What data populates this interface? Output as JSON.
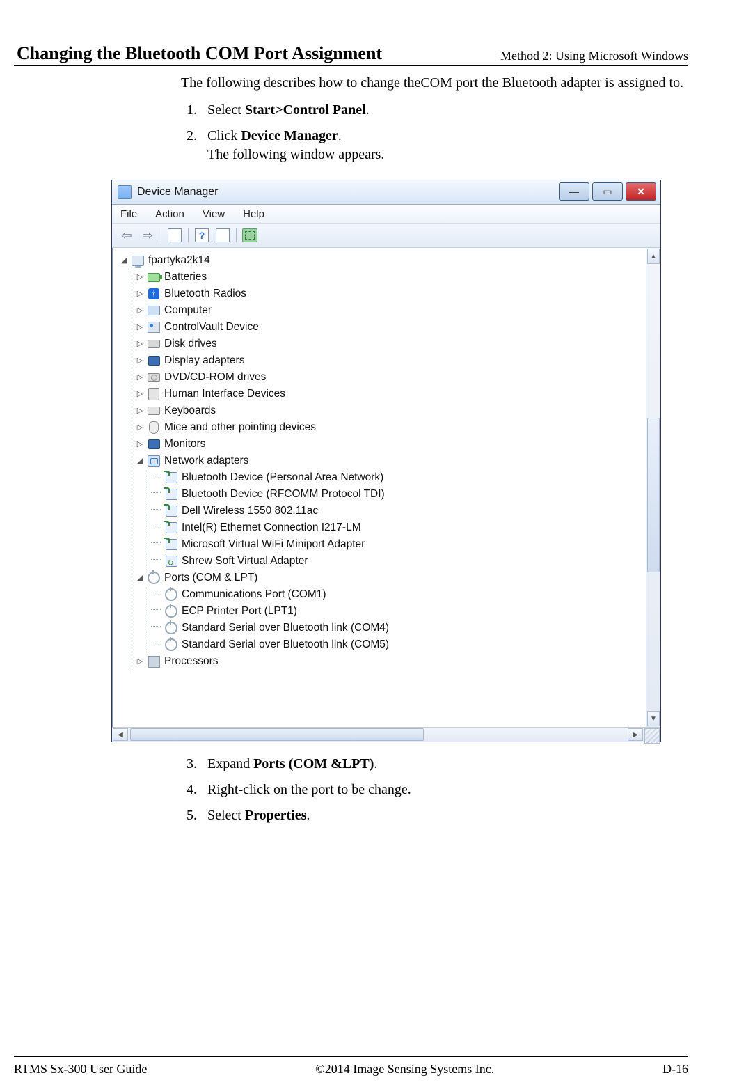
{
  "header": {
    "right": "Method 2: Using Microsoft Windows"
  },
  "section_title": "Changing the Bluetooth COM Port Assignment",
  "intro": "The following describes how to change theCOM port the Bluetooth adapter is assigned to.",
  "steps_top": {
    "s1_pre": "Select ",
    "s1_bold": "Start>Control Panel",
    "s2_pre": "Click ",
    "s2_bold": "Device Manager",
    "s2_note": "The following window appears."
  },
  "dm": {
    "title": "Device Manager",
    "menu": {
      "file": "File",
      "action": "Action",
      "view": "View",
      "help": "Help"
    },
    "root": "fpartyka2k14",
    "nodes": {
      "batteries": "Batteries",
      "bt_radios": "Bluetooth Radios",
      "computer": "Computer",
      "cv": "ControlVault Device",
      "disk": "Disk drives",
      "display": "Display adapters",
      "dvd": "DVD/CD-ROM drives",
      "hid": "Human Interface Devices",
      "kb": "Keyboards",
      "mouse": "Mice and other pointing devices",
      "mon": "Monitors",
      "net": "Network adapters",
      "ports": "Ports (COM & LPT)",
      "proc": "Processors"
    },
    "net_children": {
      "a": "Bluetooth Device (Personal Area Network)",
      "b": "Bluetooth Device (RFCOMM Protocol TDI)",
      "c": "Dell Wireless 1550 802.11ac",
      "d": "Intel(R) Ethernet Connection I217-LM",
      "e": "Microsoft Virtual WiFi Miniport Adapter",
      "f": "Shrew Soft Virtual Adapter"
    },
    "port_children": {
      "a": "Communications Port (COM1)",
      "b": "ECP Printer Port (LPT1)",
      "c": "Standard Serial over Bluetooth link (COM4)",
      "d": "Standard Serial over Bluetooth link (COM5)"
    },
    "btn": {
      "min": "—",
      "max": "▭",
      "close": "✕"
    }
  },
  "steps_bottom": {
    "s3_pre": "Expand ",
    "s3_bold": "Ports (COM &LPT)",
    "s4": "Right-click on the port to be change.",
    "s5_pre": "Select ",
    "s5_bold": "Properties"
  },
  "footer": {
    "left": "RTMS Sx-300 User Guide",
    "center": "©2014 Image Sensing Systems Inc.",
    "right": "D-16"
  }
}
